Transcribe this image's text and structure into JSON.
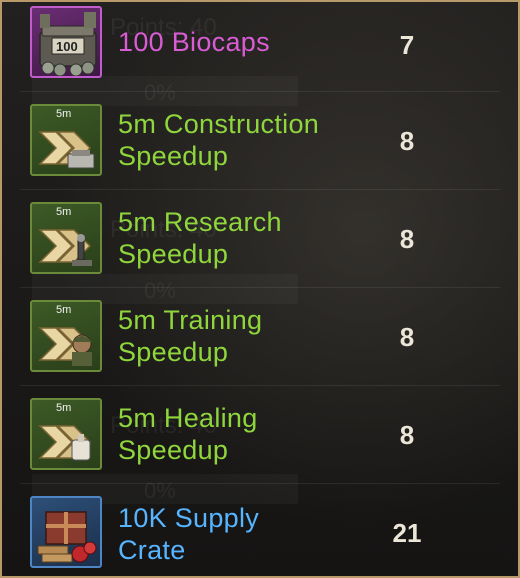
{
  "background": {
    "ghost_texts": [
      "Points: 40",
      "0%",
      "Points: 40",
      "0%",
      "Points: 40",
      "0%"
    ]
  },
  "rows": [
    {
      "name": "100 Biocaps",
      "points": "7",
      "icon": "biocaps-icon",
      "icon_label": "100",
      "color": "#d85cd4"
    },
    {
      "name_line1": "5m Construction",
      "name_line2": "Speedup",
      "points": "8",
      "icon": "construction-speedup-icon",
      "time": "5m",
      "color": "#8fd63c"
    },
    {
      "name_line1": "5m Research",
      "name_line2": "Speedup",
      "points": "8",
      "icon": "research-speedup-icon",
      "time": "5m",
      "color": "#8fd63c"
    },
    {
      "name_line1": "5m Training",
      "name_line2": "Speedup",
      "points": "8",
      "icon": "training-speedup-icon",
      "time": "5m",
      "color": "#8fd63c"
    },
    {
      "name_line1": "5m Healing",
      "name_line2": "Speedup",
      "points": "8",
      "icon": "healing-speedup-icon",
      "time": "5m",
      "color": "#8fd63c"
    },
    {
      "name_line1": "10K Supply",
      "name_line2": "Crate",
      "points": "21",
      "icon": "supply-crate-icon",
      "color": "#57b4ff"
    }
  ]
}
